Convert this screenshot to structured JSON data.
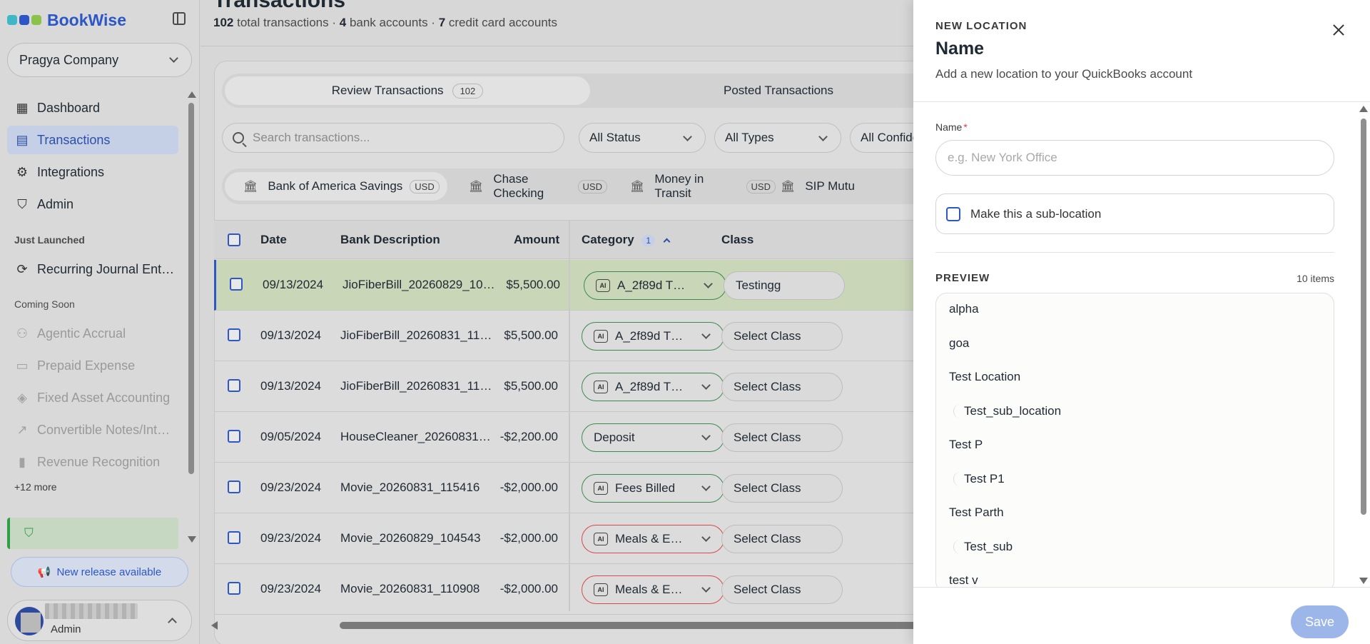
{
  "brand": {
    "name": "BookWise",
    "dot_colors": [
      "#3fb7c7",
      "#2d56c6",
      "#8bc34a"
    ]
  },
  "company": {
    "name": "Pragya Company"
  },
  "sidebar": {
    "items": [
      {
        "label": "Dashboard",
        "icon": "dashboard-icon"
      },
      {
        "label": "Transactions",
        "icon": "receipt-icon",
        "active": true
      },
      {
        "label": "Integrations",
        "icon": "gear-icon"
      },
      {
        "label": "Admin",
        "icon": "shield-icon"
      }
    ],
    "just_launched_label": "Just Launched",
    "just_launched": [
      {
        "label": "Recurring Journal Ent…",
        "icon": "refresh-icon"
      }
    ],
    "coming_soon_label": "Coming Soon",
    "coming_soon": [
      {
        "label": "Agentic Accrual",
        "icon": "robot-icon"
      },
      {
        "label": "Prepaid Expense",
        "icon": "calendar-icon"
      },
      {
        "label": "Fixed Asset Accounting",
        "icon": "box-icon"
      },
      {
        "label": "Convertible Notes/Int…",
        "icon": "trend-icon"
      },
      {
        "label": "Revenue Recognition",
        "icon": "bar-chart-icon"
      }
    ],
    "more_label": "+12 more",
    "release_label": "New release available",
    "user_role": "Admin"
  },
  "header": {
    "title": "Transactions",
    "total_count": "102",
    "total_label": "total transactions",
    "bank_count": "4",
    "bank_label": "bank accounts",
    "cc_count": "7",
    "cc_label": "credit card accounts"
  },
  "tabs": [
    {
      "label": "Review Transactions",
      "count": "102"
    },
    {
      "label": "Posted Transactions"
    }
  ],
  "search": {
    "placeholder": "Search transactions..."
  },
  "filters": [
    "All Status",
    "All Types",
    "All Confide"
  ],
  "accounts": [
    {
      "label": "Bank of America Savings",
      "currency": "USD"
    },
    {
      "label": "Chase Checking",
      "currency": "USD"
    },
    {
      "label": "Money in Transit",
      "currency": "USD"
    },
    {
      "label": "SIP Mutu",
      "currency": ""
    }
  ],
  "table": {
    "headers": {
      "date": "Date",
      "desc": "Bank Description",
      "amount": "Amount",
      "category": "Category",
      "category_count": "1",
      "class": "Class"
    },
    "rows": [
      {
        "date": "09/13/2024",
        "desc": "JioFiberBill_20260829_10…",
        "amount": "$5,500.00",
        "category": "A_2f89d T…",
        "ai": true,
        "cat_color": "green",
        "class": "Testingg",
        "selected": true
      },
      {
        "date": "09/13/2024",
        "desc": "JioFiberBill_20260831_11…",
        "amount": "$5,500.00",
        "category": "A_2f89d T…",
        "ai": true,
        "cat_color": "green",
        "class": "Select Class"
      },
      {
        "date": "09/13/2024",
        "desc": "JioFiberBill_20260831_11…",
        "amount": "$5,500.00",
        "category": "A_2f89d T…",
        "ai": true,
        "cat_color": "green",
        "class": "Select Class"
      },
      {
        "date": "09/05/2024",
        "desc": "HouseCleaner_20260831…",
        "amount": "-$2,200.00",
        "category": "Deposit",
        "ai": false,
        "cat_color": "green",
        "class": "Select Class"
      },
      {
        "date": "09/23/2024",
        "desc": "Movie_20260831_115416",
        "amount": "-$2,000.00",
        "category": "Fees Billed",
        "ai": true,
        "cat_color": "green",
        "class": "Select Class"
      },
      {
        "date": "09/23/2024",
        "desc": "Movie_20260829_104543",
        "amount": "-$2,000.00",
        "category": "Meals & E…",
        "ai": true,
        "cat_color": "red",
        "class": "Select Class"
      },
      {
        "date": "09/23/2024",
        "desc": "Movie_20260831_110908",
        "amount": "-$2,000.00",
        "category": "Meals & E…",
        "ai": true,
        "cat_color": "red",
        "class": "Select Class"
      }
    ]
  },
  "drawer": {
    "eyebrow": "NEW LOCATION",
    "title": "Name",
    "subtitle": "Add a new location to your QuickBooks account",
    "name_label": "Name",
    "required_mark": "*",
    "name_placeholder": "e.g. New York Office",
    "name_value": "",
    "sublocation_label": "Make this a sub-location",
    "preview_label": "PREVIEW",
    "preview_count": "10 items",
    "preview_items": [
      {
        "label": "alpha",
        "child": false
      },
      {
        "label": "goa",
        "child": false
      },
      {
        "label": "Test Location",
        "child": false
      },
      {
        "label": "Test_sub_location",
        "child": true
      },
      {
        "label": "Test P",
        "child": false
      },
      {
        "label": "Test P1",
        "child": true
      },
      {
        "label": "Test Parth",
        "child": false
      },
      {
        "label": "Test_sub",
        "child": true
      },
      {
        "label": "test v",
        "child": false
      }
    ],
    "save_label": "Save"
  }
}
